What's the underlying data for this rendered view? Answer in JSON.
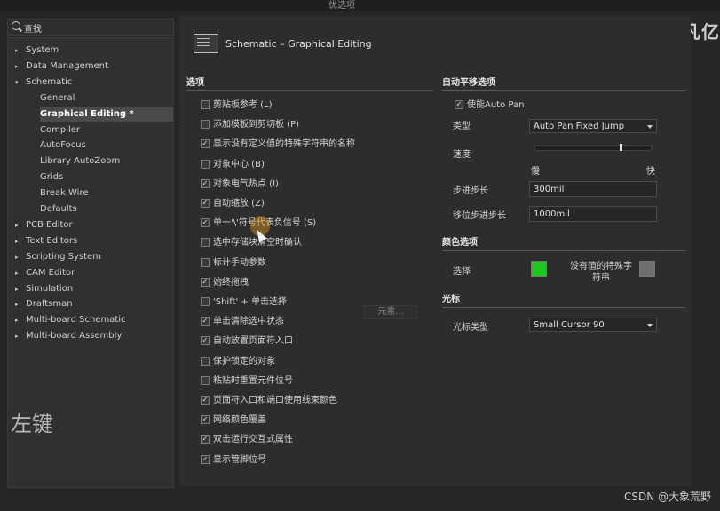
{
  "window": {
    "title": "优选项",
    "brand": "凡亿"
  },
  "search": {
    "placeholder": "查找"
  },
  "tree": {
    "items": [
      {
        "label": "System",
        "level": 0,
        "arrow": "▸"
      },
      {
        "label": "Data Management",
        "level": 0,
        "arrow": "▸"
      },
      {
        "label": "Schematic",
        "level": 0,
        "arrow": "▾"
      },
      {
        "label": "General",
        "level": 1
      },
      {
        "label": "Graphical Editing *",
        "level": 1,
        "selected": true
      },
      {
        "label": "Compiler",
        "level": 1
      },
      {
        "label": "AutoFocus",
        "level": 1
      },
      {
        "label": "Library AutoZoom",
        "level": 1
      },
      {
        "label": "Grids",
        "level": 1
      },
      {
        "label": "Break Wire",
        "level": 1
      },
      {
        "label": "Defaults",
        "level": 1
      },
      {
        "label": "PCB Editor",
        "level": 0,
        "arrow": "▸"
      },
      {
        "label": "Text Editors",
        "level": 0,
        "arrow": "▸"
      },
      {
        "label": "Scripting System",
        "level": 0,
        "arrow": "▸"
      },
      {
        "label": "CAM Editor",
        "level": 0,
        "arrow": "▸"
      },
      {
        "label": "Simulation",
        "level": 0,
        "arrow": "▸"
      },
      {
        "label": "Draftsman",
        "level": 0,
        "arrow": "▸"
      },
      {
        "label": "Multi-board Schematic",
        "level": 0,
        "arrow": "▸"
      },
      {
        "label": "Multi-board Assembly",
        "level": 0,
        "arrow": "▸"
      }
    ]
  },
  "header": {
    "title": "Schematic – Graphical Editing"
  },
  "options": {
    "title": "选项",
    "items": [
      {
        "label": "剪贴板参考 (L)",
        "checked": false
      },
      {
        "label": "添加模板到剪切板 (P)",
        "checked": false
      },
      {
        "label": "显示没有定义值的特殊字符串的名称",
        "checked": true
      },
      {
        "label": "对象中心 (B)",
        "checked": false
      },
      {
        "label": "对象电气热点 (I)",
        "checked": true
      },
      {
        "label": "自动缩放 (Z)",
        "checked": true
      },
      {
        "label": "单一'\\'符号代表负信号 (S)",
        "checked": true
      },
      {
        "label": "选中存储块清空时确认",
        "checked": false
      },
      {
        "label": "标计手动参数",
        "checked": false
      },
      {
        "label": "始终拖拽",
        "checked": true
      },
      {
        "label": "'Shift' + 单击选择",
        "checked": false
      },
      {
        "label": "单击清除选中状态",
        "checked": true
      },
      {
        "label": "自动放置页面符入口",
        "checked": true
      },
      {
        "label": "保护锁定的对象",
        "checked": false
      },
      {
        "label": "粘贴时重置元件位号",
        "checked": false
      },
      {
        "label": "页面符入口和端口使用线束颜色",
        "checked": true
      },
      {
        "label": "网络颜色覆盖",
        "checked": true
      },
      {
        "label": "双击运行交互式属性",
        "checked": true
      },
      {
        "label": "显示管脚位号",
        "checked": true
      }
    ],
    "elements_button": "元素..."
  },
  "autopan": {
    "title": "自动平移选项",
    "enable_label": "使能Auto Pan",
    "enable_checked": true,
    "type_label": "类型",
    "type_value": "Auto Pan Fixed Jump",
    "speed_label": "速度",
    "speed_fraction": 0.74,
    "slow_label": "慢",
    "fast_label": "快",
    "step_label": "步进步长",
    "step_value": "300mil",
    "shift_step_label": "移位步进步长",
    "shift_step_value": "1000mil"
  },
  "colors": {
    "title": "颜色选项",
    "select_label": "选择",
    "select_color": "#1ec81e",
    "novalue_label": "没有值的特殊字符串",
    "novalue_color": "#6e6e6e"
  },
  "cursor": {
    "title": "光标",
    "type_label": "光标类型",
    "type_value": "Small Cursor 90"
  },
  "overlay": {
    "left_key": "左键",
    "watermark": "CSDN @大象荒野"
  }
}
